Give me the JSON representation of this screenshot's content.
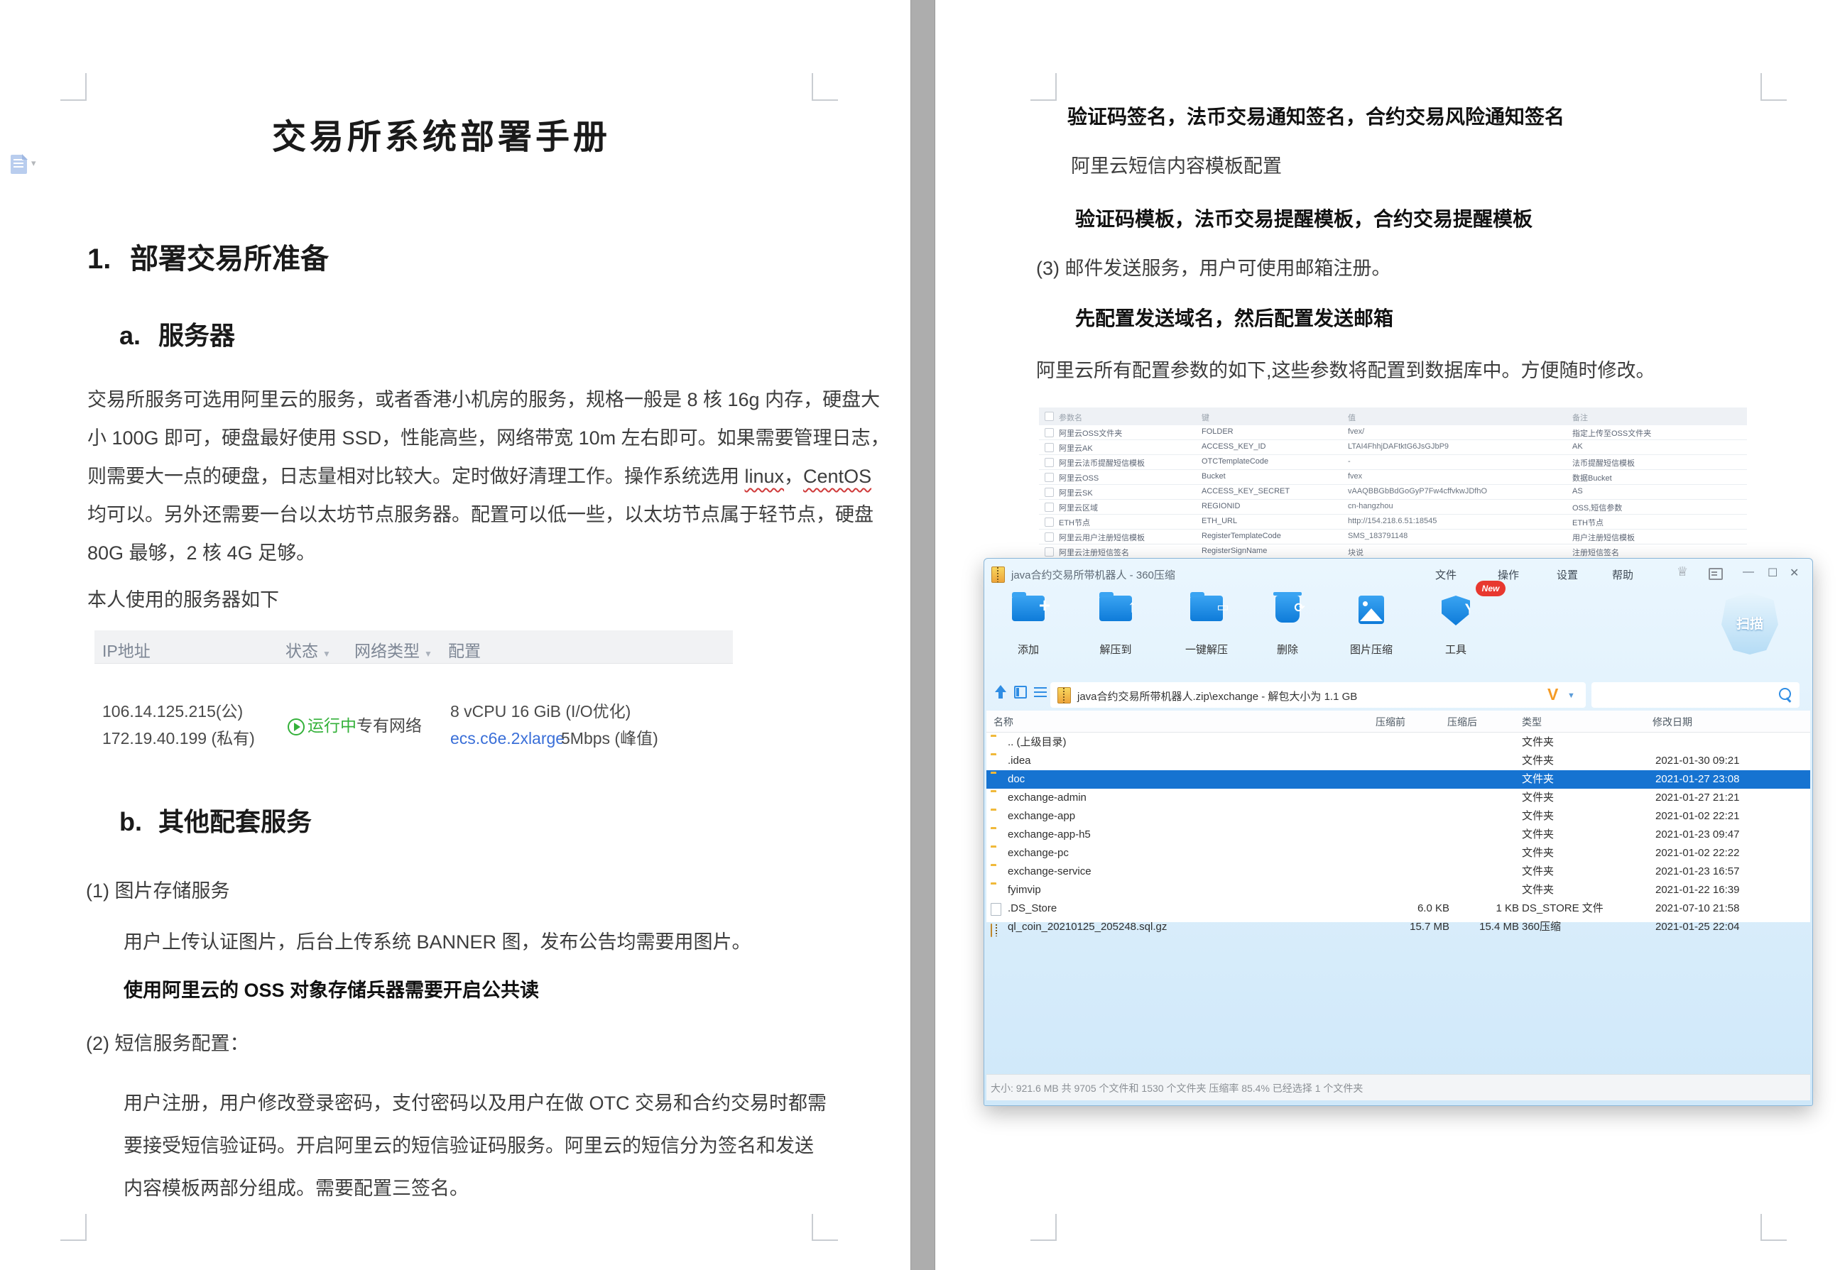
{
  "accent": {
    "word_blue_link": "#3a6fd8",
    "zip_selection": "#1673d1",
    "zip_chrome": "#d9edfb",
    "toolbar_icon_blue": "#168ae0",
    "green_running": "#34b13a",
    "orange_v": "#f59b25",
    "badge_red": "#e8382f"
  },
  "doc": {
    "title": "交易所系统部署手册",
    "h1_num": "1.",
    "h1": "部署交易所准备",
    "h2a_num": "a.",
    "h2a": "服务器",
    "para1_l1": "交易所服务可选用阿里云的服务，或者香港小机房的服务，规格一般是 8 核 16g 内存，硬盘大",
    "para1_l2": "小 100G 即可，硬盘最好使用 SSD，性能高些，网络带宽 10m 左右即可。如果需要管理日志，",
    "para1_l3_pre": "则需要大一点的硬盘，日志量相对比较大。定时做好清理工作。操作系统选用 ",
    "para1_l3_u1": "linux",
    "para1_l3_mid": "，",
    "para1_l3_u2": "CentOS",
    "para1_l4": "均可以。另外还需要一台以太坊节点服务器。配置可以低一些，以太坊节点属于轻节点，硬盘",
    "para1_l5": "80G 最够，2 核 4G 足够。",
    "note": "本人使用的服务器如下",
    "server_table": {
      "h_ip": "IP地址",
      "h_status": "状态",
      "h_net": "网络类型",
      "h_cfg": "配置",
      "ip_pub": "106.14.125.215(公)",
      "ip_pri": "172.19.40.199 (私有)",
      "status": "运行中",
      "net": "专有网络",
      "cfg1": "8 vCPU 16 GiB  (I/O优化)",
      "cfg_ecs": "ecs.c6e.2xlarge",
      "cfg_bw": "5Mbps (峰值)"
    },
    "h2b_num": "b.",
    "h2b": "其他配套服务",
    "item1": "(1) 图片存储服务",
    "item1_text": "用户上传认证图片，后台上传系统 BANNER 图，发布公告均需要用图片。",
    "item1_bold": "使用阿里云的  OSS 对象存储兵器需要开启公共读",
    "item2": "(2) 短信服务配置：",
    "item2_l1": "用户注册，用户修改登录密码，支付密码以及用户在做 OTC 交易和合约交易时都需",
    "item2_l2": "要接受短信验证码。开启阿里云的短信验证码服务。阿里云的短信分为签名和发送",
    "item2_l3": "内容模板两部分组成。需要配置三签名。"
  },
  "page2": {
    "bold1": "验证码签名，法币交易通知签名，合约交易风险通知签名",
    "line2": "阿里云短信内容模板配置",
    "bold3": "验证码模板，法币交易提醒模板，合约交易提醒模板",
    "item3": "(3) 邮件发送服务，用户可使用邮箱注册。",
    "bold4": "先配置发送域名，然后配置发送邮箱",
    "line5": "阿里云所有配置参数的如下,这些参数将配置到数据库中。方便随时修改。",
    "config_table": {
      "headers": [
        "参数名",
        "键",
        "值",
        "备注"
      ],
      "rows": [
        [
          "阿里云OSS文件夹",
          "FOLDER",
          "fvex/",
          "指定上传至OSS文件夹"
        ],
        [
          "阿里云AK",
          "ACCESS_KEY_ID",
          "LTAI4FhhjDAFtktG6JsGJbP9",
          "AK"
        ],
        [
          "阿里云法币提醒短信模板",
          "OTCTemplateCode",
          "-",
          "法币提醒短信模板"
        ],
        [
          "阿里云OSS",
          "Bucket",
          "fvex",
          "数据Bucket"
        ],
        [
          "阿里云SK",
          "ACCESS_KEY_SECRET",
          "vAAQBBGbBdGoGyP7Fw4cffvkwJDfhO",
          "AS"
        ],
        [
          "阿里云区域",
          "REGIONID",
          "cn-hangzhou",
          "OSS,短信参数"
        ],
        [
          "ETH节点",
          "ETH_URL",
          "http://154.218.6.51:18545",
          "ETH节点"
        ],
        [
          "阿里云用户注册短信模板",
          "RegisterTemplateCode",
          "SMS_183791148",
          "用户注册短信模板"
        ],
        [
          "阿里云注册短信签名",
          "RegisterSignName",
          "块说",
          "注册短信签名"
        ]
      ]
    }
  },
  "zip": {
    "title": "java合约交易所带机器人 - 360压缩",
    "menus": [
      "文件",
      "操作",
      "设置",
      "帮助"
    ],
    "win_min": "—",
    "win_max": "☐",
    "win_close": "✕",
    "toolbar": [
      {
        "label": "添加",
        "icon": "add-folder"
      },
      {
        "label": "解压到",
        "icon": "extract-to-folder"
      },
      {
        "label": "一键解压",
        "icon": "one-click-extract"
      },
      {
        "label": "删除",
        "icon": "delete-trash"
      },
      {
        "label": "图片压缩",
        "icon": "image-compress"
      },
      {
        "label": "工具",
        "icon": "tools-shield"
      }
    ],
    "new_badge": "New",
    "scan": "扫描",
    "path": "java合约交易所带机器人.zip\\exchange - 解包大小为 1.1 GB",
    "v_mark": "V",
    "columns": [
      "名称",
      "压缩前",
      "压缩后",
      "类型",
      "修改日期"
    ],
    "files": [
      {
        "name": ".. (上级目录)",
        "before": "",
        "after": "",
        "type": "文件夹",
        "date": "",
        "icon": "folder",
        "selected": false
      },
      {
        "name": ".idea",
        "before": "",
        "after": "",
        "type": "文件夹",
        "date": "2021-01-30 09:21",
        "icon": "folder",
        "selected": false
      },
      {
        "name": "doc",
        "before": "",
        "after": "",
        "type": "文件夹",
        "date": "2021-01-27 23:08",
        "icon": "folder",
        "selected": true
      },
      {
        "name": "exchange-admin",
        "before": "",
        "after": "",
        "type": "文件夹",
        "date": "2021-01-27 21:21",
        "icon": "folder",
        "selected": false
      },
      {
        "name": "exchange-app",
        "before": "",
        "after": "",
        "type": "文件夹",
        "date": "2021-01-02 22:21",
        "icon": "folder",
        "selected": false
      },
      {
        "name": "exchange-app-h5",
        "before": "",
        "after": "",
        "type": "文件夹",
        "date": "2021-01-23 09:47",
        "icon": "folder",
        "selected": false
      },
      {
        "name": "exchange-pc",
        "before": "",
        "after": "",
        "type": "文件夹",
        "date": "2021-01-02 22:22",
        "icon": "folder",
        "selected": false
      },
      {
        "name": "exchange-service",
        "before": "",
        "after": "",
        "type": "文件夹",
        "date": "2021-01-23 16:57",
        "icon": "folder",
        "selected": false
      },
      {
        "name": "fyimvip",
        "before": "",
        "after": "",
        "type": "文件夹",
        "date": "2021-01-22 16:39",
        "icon": "folder",
        "selected": false
      },
      {
        "name": ".DS_Store",
        "before": "6.0 KB",
        "after": "1 KB",
        "type": "DS_STORE 文件",
        "date": "2021-07-10 21:58",
        "icon": "file",
        "selected": false
      },
      {
        "name": "ql_coin_20210125_205248.sql.gz",
        "before": "15.7 MB",
        "after": "15.4 MB",
        "type": "360压缩",
        "date": "2021-01-25 22:04",
        "icon": "zip",
        "selected": false
      }
    ],
    "status": "大小: 921.6 MB 共 9705 个文件和 1530 个文件夹 压缩率 85.4% 已经选择 1 个文件夹"
  }
}
